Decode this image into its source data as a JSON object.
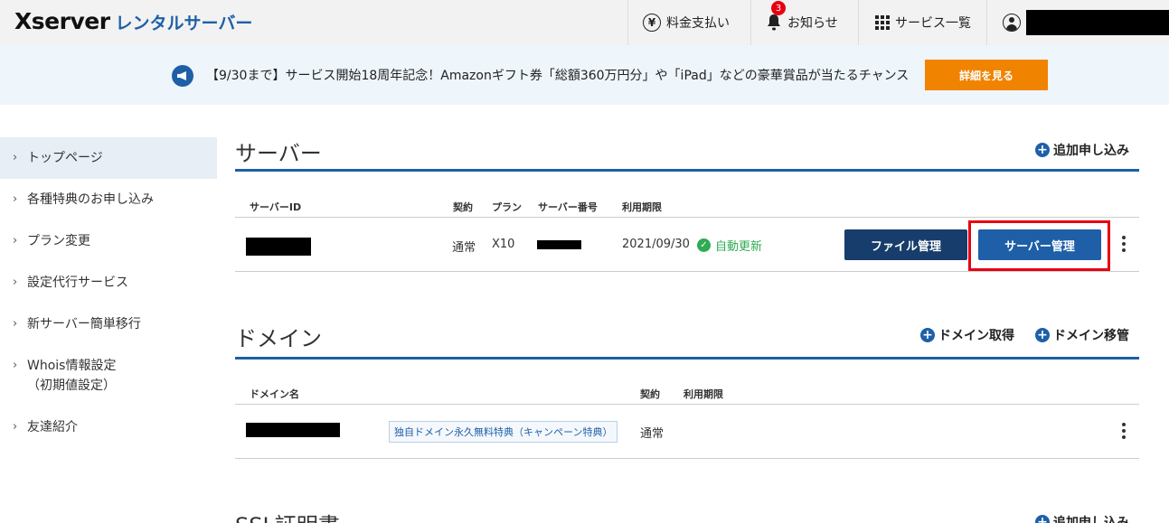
{
  "header": {
    "logo_brand": "Xserver",
    "logo_product": "レンタルサーバー",
    "nav": {
      "payment": "料金支払い",
      "notice": "お知らせ",
      "notice_count": "3",
      "services": "サービス一覧"
    }
  },
  "banner": {
    "text": "【9/30まで】サービス開始18周年記念！Amazonギフト券「総額360万円分」や「iPad」などの豪華賞品が当たるチャンス",
    "button": "詳細を見る"
  },
  "sidebar": {
    "items": [
      {
        "label": "トップページ"
      },
      {
        "label": "各種特典のお申し込み"
      },
      {
        "label": "プラン変更"
      },
      {
        "label": "設定代行サービス"
      },
      {
        "label": "新サーバー簡単移行"
      },
      {
        "label": "Whois情報設定\n（初期値設定）"
      },
      {
        "label": "友達紹介"
      }
    ]
  },
  "server": {
    "title": "サーバー",
    "add_label": "追加申し込み",
    "headers": {
      "id": "サーバーID",
      "contract": "契約",
      "plan": "プラン",
      "number": "サーバー番号",
      "expiry": "利用期限"
    },
    "row": {
      "contract": "通常",
      "plan": "X10",
      "expiry": "2021/09/30",
      "auto_renew": "自動更新"
    },
    "file_button": "ファイル管理",
    "manage_button": "サーバー管理"
  },
  "domain": {
    "title": "ドメイン",
    "acquire_label": "ドメイン取得",
    "transfer_label": "ドメイン移管",
    "headers": {
      "name": "ドメイン名",
      "contract": "契約",
      "expiry": "利用期限"
    },
    "row": {
      "tag": "独自ドメイン永久無料特典（キャンペーン特典）",
      "contract": "通常"
    }
  },
  "ssl": {
    "title": "SSL証明書",
    "add_label": "追加申し込み"
  },
  "colors": {
    "brand_blue": "#1e5fa8",
    "accent_orange": "#f08300",
    "highlight_red": "#e60012",
    "renew_green": "#2eab53"
  }
}
